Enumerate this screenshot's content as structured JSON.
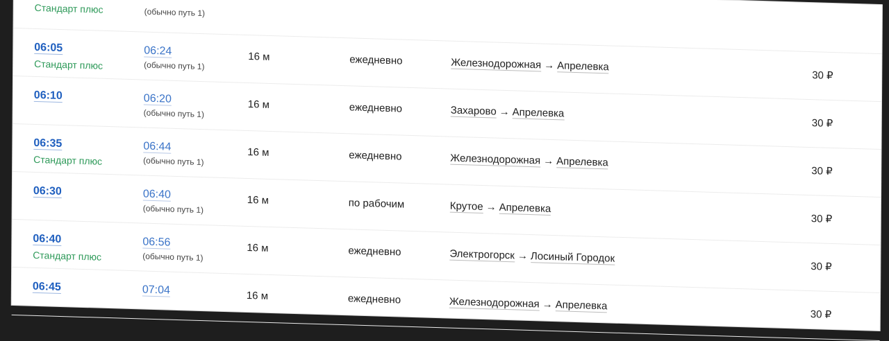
{
  "top_partial": {
    "train_type": "Стандарт плюс",
    "note": "(обычно путь 1)"
  },
  "rows": [
    {
      "dep": "06:05",
      "train_type": "Стандарт плюс",
      "arr": "06:24",
      "arr_note": "(обычно путь 1)",
      "duration": "16 м",
      "days": "ежедневно",
      "from": "Железнодорожная",
      "arrow": "→",
      "to": "Апрелевка",
      "price": "30 ₽"
    },
    {
      "dep": "06:10",
      "train_type": "",
      "arr": "06:20",
      "arr_note": "(обычно путь 1)",
      "duration": "16 м",
      "days": "ежедневно",
      "from": "Захарово",
      "arrow": "→",
      "to": "Апрелевка",
      "price": "30 ₽"
    },
    {
      "dep": "06:35",
      "train_type": "Стандарт плюс",
      "arr": "06:44",
      "arr_note": "(обычно путь 1)",
      "duration": "16 м",
      "days": "ежедневно",
      "from": "Железнодорожная",
      "arrow": "→",
      "to": "Апрелевка",
      "price": "30 ₽"
    },
    {
      "dep": "06:30",
      "train_type": "",
      "arr": "06:40",
      "arr_note": "(обычно путь 1)",
      "duration": "16 м",
      "days": "по рабочим",
      "from": "Крутое",
      "arrow": "→",
      "to": "Апрелевка",
      "price": "30 ₽"
    },
    {
      "dep": "06:40",
      "train_type": "Стандарт плюс",
      "arr": "06:56",
      "arr_note": "(обычно путь 1)",
      "duration": "16 м",
      "days": "ежедневно",
      "from": "Электрогорск",
      "arrow": "→",
      "to": "Лосиный Городок",
      "price": "30 ₽"
    },
    {
      "dep": "06:45",
      "train_type": "",
      "arr": "07:04",
      "arr_note": "",
      "duration": "16 м",
      "days": "ежедневно",
      "from": "Железнодорожная",
      "arrow": "→",
      "to": "Апрелевка",
      "price": "30 ₽"
    }
  ]
}
